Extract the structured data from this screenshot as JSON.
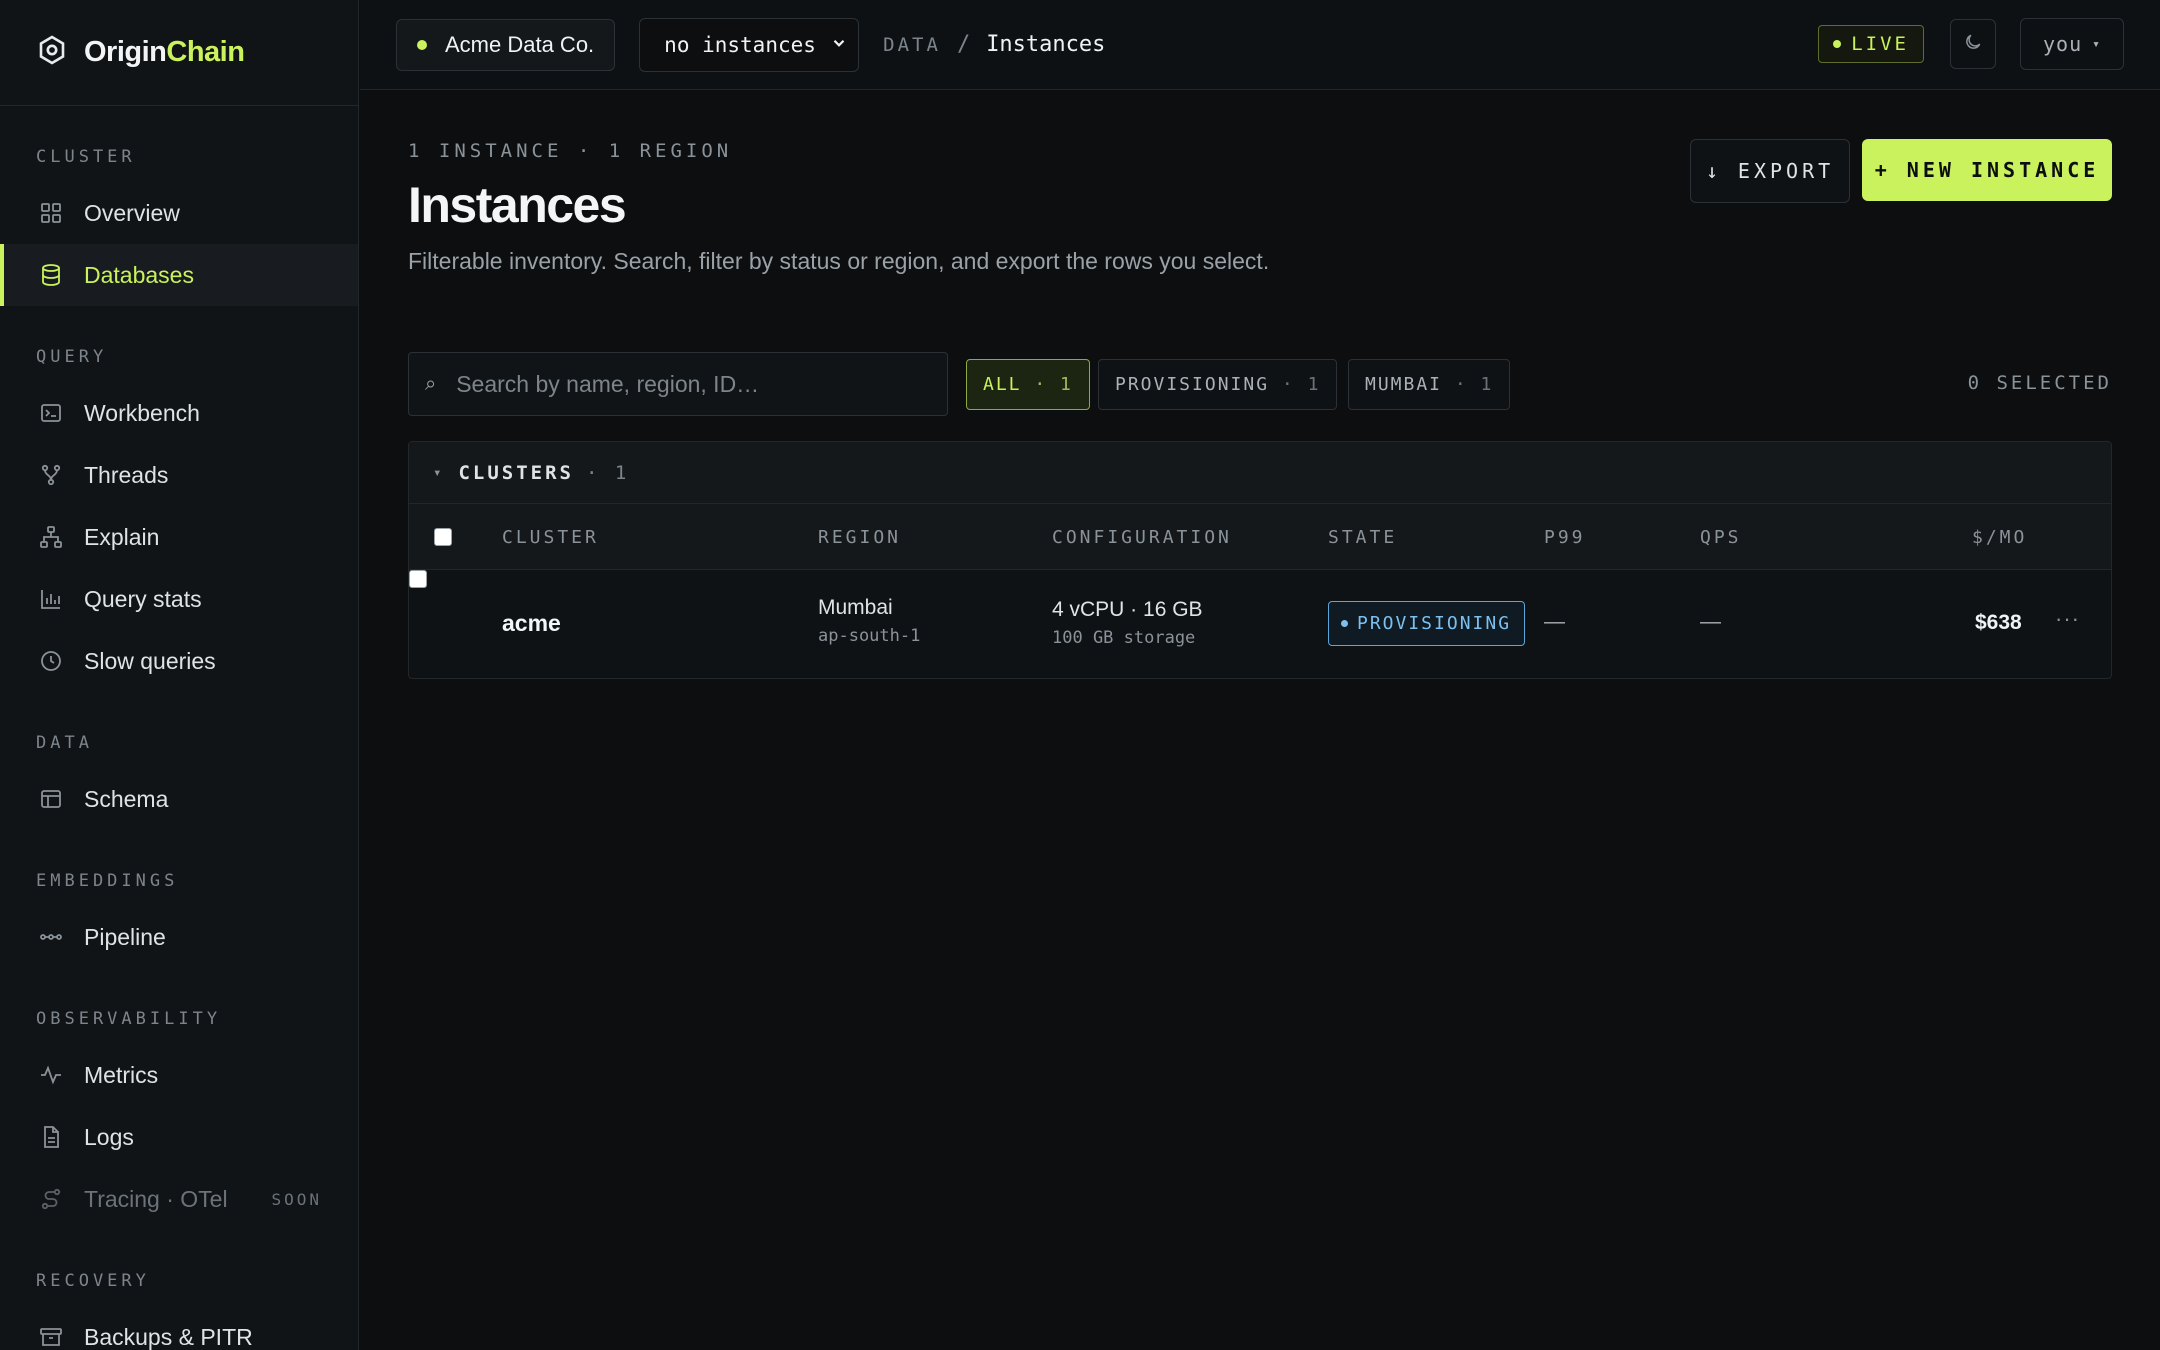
{
  "brand": {
    "name_part1": "Origin",
    "name_part2": "Chain"
  },
  "sidebar": {
    "sections": [
      {
        "heading": "CLUSTER",
        "items": [
          {
            "label": "Overview",
            "icon": "grid-icon"
          },
          {
            "label": "Databases",
            "icon": "database-icon",
            "active": true
          }
        ]
      },
      {
        "heading": "QUERY",
        "items": [
          {
            "label": "Workbench",
            "icon": "terminal-icon"
          },
          {
            "label": "Threads",
            "icon": "branch-icon"
          },
          {
            "label": "Explain",
            "icon": "hierarchy-icon"
          },
          {
            "label": "Query stats",
            "icon": "bar-chart-icon"
          },
          {
            "label": "Slow queries",
            "icon": "clock-icon"
          }
        ]
      },
      {
        "heading": "DATA",
        "items": [
          {
            "label": "Schema",
            "icon": "table-icon"
          }
        ]
      },
      {
        "heading": "EMBEDDINGS",
        "items": [
          {
            "label": "Pipeline",
            "icon": "pipeline-icon"
          }
        ]
      },
      {
        "heading": "OBSERVABILITY",
        "items": [
          {
            "label": "Metrics",
            "icon": "activity-icon"
          },
          {
            "label": "Logs",
            "icon": "file-icon"
          },
          {
            "label": "Tracing · OTel",
            "icon": "route-icon",
            "disabled": true,
            "badge": "SOON"
          }
        ]
      },
      {
        "heading": "RECOVERY",
        "items": [
          {
            "label": "Backups & PITR",
            "icon": "archive-icon"
          }
        ]
      }
    ]
  },
  "topbar": {
    "org": "Acme Data Co.",
    "instance_select": "no instances",
    "breadcrumb": {
      "section": "DATA",
      "separator": "/",
      "page": "Instances"
    },
    "live": "LIVE",
    "user": "you",
    "user_caret": "▾"
  },
  "header": {
    "meta": "1 INSTANCE · 1 REGION",
    "title": "Instances",
    "subtitle": "Filterable inventory. Search, filter by status or region, and export the rows you select.",
    "export_label": "↓ EXPORT",
    "new_label": "+ NEW INSTANCE"
  },
  "filters": {
    "search_placeholder": "Search by name, region, ID…",
    "search_icon": "⌕",
    "chips": [
      {
        "label": "ALL",
        "count": "· 1",
        "active": true
      },
      {
        "label": "PROVISIONING",
        "count": "· 1"
      },
      {
        "label": "MUMBAI",
        "count": "· 1"
      }
    ],
    "selected": "0 SELECTED"
  },
  "table": {
    "group": {
      "toggle": "▾",
      "label": "CLUSTERS",
      "count": "· 1"
    },
    "columns": [
      "CLUSTER",
      "REGION",
      "CONFIGURATION",
      "STATE",
      "P99",
      "QPS",
      "$/MO"
    ],
    "rows": [
      {
        "cluster": "acme",
        "region": "Mumbai",
        "region_code": "ap-south-1",
        "config": "4 vCPU · 16 GB",
        "storage": "100 GB storage",
        "state": "PROVISIONING",
        "p99": "—",
        "qps": "—",
        "cost": "$638",
        "more": "···"
      }
    ]
  },
  "colors": {
    "accent": "#c9f25c",
    "state_provisioning": "#7cc0f0",
    "background": "#0c0e10"
  }
}
